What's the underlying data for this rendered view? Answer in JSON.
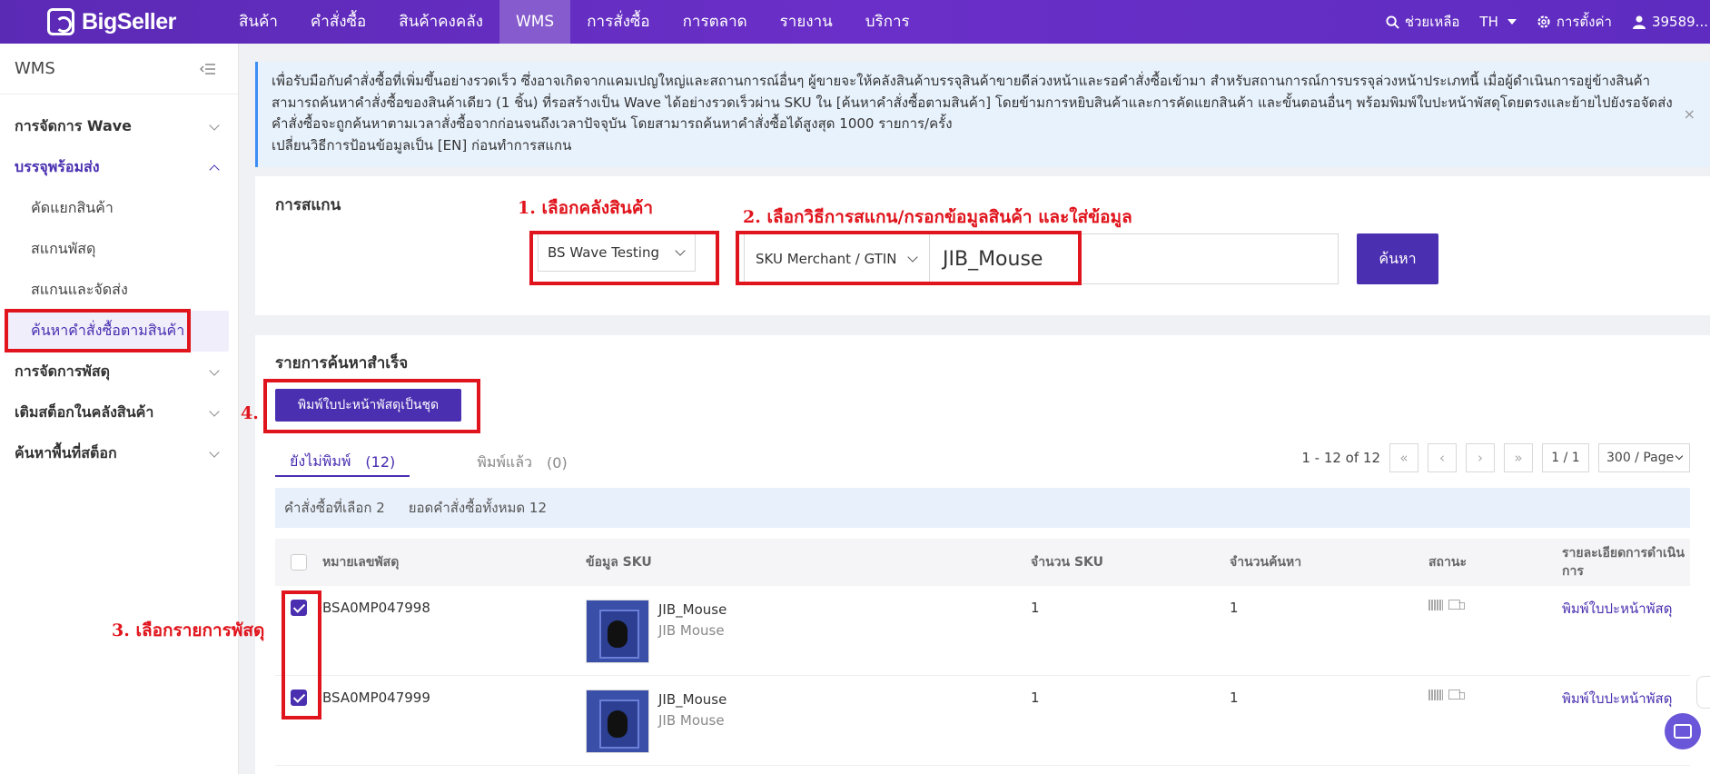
{
  "app": {
    "logo_text": "BigSeller",
    "nav": [
      "สินค้า",
      "คำสั่งซื้อ",
      "สินค้าคงคลัง",
      "WMS",
      "การสั่งซื้อ",
      "การตลาด",
      "รายงาน",
      "บริการ"
    ],
    "nav_active": "WMS",
    "help": "ช่วยเหลือ",
    "lang": "TH",
    "settings": "การตั้งค่า",
    "user": "39589..."
  },
  "sidebar": {
    "title": "WMS",
    "groups": [
      {
        "label": "การจัดการ Wave"
      },
      {
        "label": "บรรจุพร้อมส่ง",
        "items": [
          "คัดแยกสินค้า",
          "สแกนพัสดุ",
          "สแกนและจัดส่ง",
          "ค้นหาคำสั่งซื้อตามสินค้า"
        ]
      },
      {
        "label": "การจัดการพัสดุ"
      },
      {
        "label": "เติมสต็อกในคลังสินค้า"
      },
      {
        "label": "ค้นหาพื้นที่สต็อก"
      }
    ]
  },
  "banner": {
    "line1": "เพื่อรับมือกับคำสั่งซื้อที่เพิ่มขึ้นอย่างรวดเร็ว ซึ่งอาจเกิดจากแคมเปญใหญ่และสถานการณ์อื่นๆ ผู้ขายจะให้คลังสินค้าบรรจุสินค้าขายดีล่วงหน้าและรอคำสั่งซื้อเข้ามา สำหรับสถานการณ์การบรรจุล่วงหน้าประเภทนี้ เมื่อผู้ดำเนินการอยู่ข้างสินค้า",
    "line2": "สามารถค้นหาคำสั่งซื้อของสินค้าเดียว (1 ชิ้น) ที่รอสร้างเป็น Wave ได้อย่างรวดเร็วผ่าน SKU ใน [ค้นหาคำสั่งซื้อตามสินค้า] โดยข้ามการหยิบสินค้าและการคัดแยกสินค้า และขั้นตอนอื่นๆ พร้อมพิมพ์ใบปะหน้าพัสดุโดยตรงและย้ายไปยังรอจัดส่ง",
    "line3": "คำสั่งซื้อจะถูกค้นหาตามเวลาสั่งซื้อจากก่อนจนถึงเวลาปัจจุบัน โดยสามารถค้นหาคำสั่งซื้อได้สูงสุด 1000 รายการ/ครั้ง",
    "line4": "เปลี่ยนวิธีการป้อนข้อมูลเป็น [EN] ก่อนทำการสแกน",
    "close": "×"
  },
  "scan": {
    "title": "การสแกน",
    "warehouse": "BS Wave Testing",
    "scan_type": "SKU Merchant / GTIN",
    "input_value": "JIB_Mouse",
    "search_btn": "ค้นหา"
  },
  "results": {
    "title": "รายการค้นหาสำเร็จ",
    "print_batch_btn": "พิมพ์ใบปะหน้าพัสดุเป็นชุด",
    "tab_unprinted": "ยังไม่พิมพ์",
    "tab_unprinted_count": "(12)",
    "tab_printed": "พิมพ์แล้ว",
    "tab_printed_count": "(0)",
    "pager_range": "1 - 12 of 12",
    "pager_first": "«",
    "pager_prev": "‹",
    "pager_next": "›",
    "pager_last": "»",
    "pager_page": "1 / 1",
    "pager_size": "300 / Page",
    "selected_text": "คำสั่งซื้อที่เลือก 2",
    "total_text": "ยอดคำสั่งซื้อทั้งหมด 12",
    "columns": {
      "package": "หมายเลขพัสดุ",
      "sku": "ข้อมูล SKU",
      "qty_sku": "จำนวน SKU",
      "qty_search": "จำนวนค้นหา",
      "status": "สถานะ",
      "action": "รายละเอียดการดำเนินการ"
    },
    "rows": [
      {
        "package": "BSA0MP047998",
        "sku": "JIB_Mouse",
        "sku_name": "JIB Mouse",
        "qty_sku": "1",
        "qty_search": "1",
        "action": "พิมพ์ใบปะหน้าพัสดุ",
        "checked": true
      },
      {
        "package": "BSA0MP047999",
        "sku": "JIB_Mouse",
        "sku_name": "JIB Mouse",
        "qty_sku": "1",
        "qty_search": "1",
        "action": "พิมพ์ใบปะหน้าพัสดุ",
        "checked": true
      }
    ]
  },
  "annotations": {
    "step1": "1. เลือกคลังสินค้า",
    "step2": "2. เลือกวิธีการสแกน/กรอกข้อมูลสินค้า และใส่ข้อมูล",
    "step3": "3. เลือกรายการพัสดุ",
    "step4": "4.",
    "color": "#e0141c"
  },
  "colors": {
    "brand": "#4a2fb0",
    "topbar": "#5e2cc0",
    "banner_bg": "#e8f2fd"
  }
}
